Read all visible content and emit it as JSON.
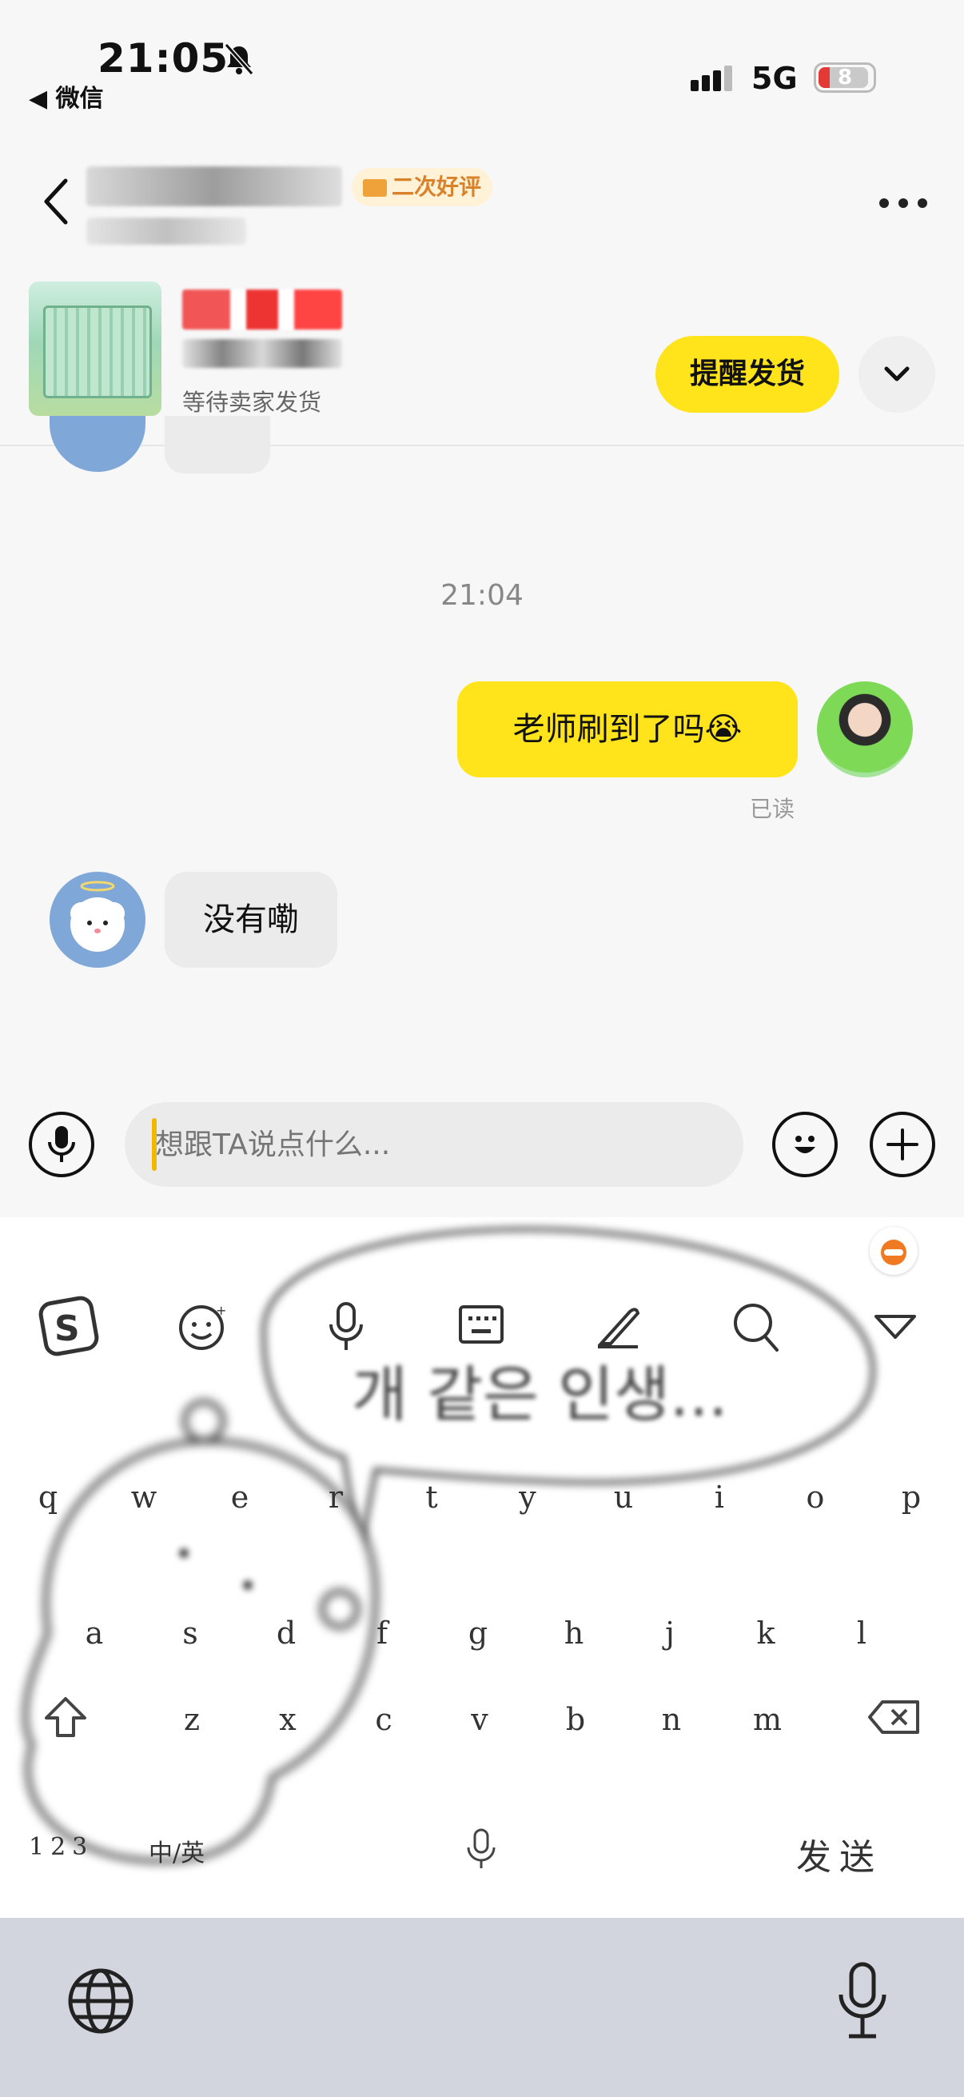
{
  "status_bar": {
    "time": "21:05",
    "back_app": "◀ 微信",
    "network": "5G",
    "battery": "8"
  },
  "header": {
    "review_tag": "二次好评"
  },
  "order_card": {
    "status": "等待卖家发货",
    "remind_button": "提醒发货"
  },
  "messages": {
    "timestamp": "21:04",
    "sent_text": "老师刷到了吗😭",
    "sent_status": "已读",
    "received_text": "没有嘞"
  },
  "composer": {
    "placeholder": "想跟TA说点什么..."
  },
  "keyboard": {
    "art_text": "개 같은 인생...",
    "row1": [
      "q",
      "w",
      "e",
      "r",
      "t",
      "y",
      "u",
      "i",
      "o",
      "p"
    ],
    "row2": [
      "a",
      "s",
      "d",
      "f",
      "g",
      "h",
      "j",
      "k",
      "l"
    ],
    "row3": [
      "z",
      "x",
      "c",
      "v",
      "b",
      "n",
      "m"
    ],
    "num_key": "123",
    "lang_key": "中/英",
    "send_key": "发送"
  }
}
